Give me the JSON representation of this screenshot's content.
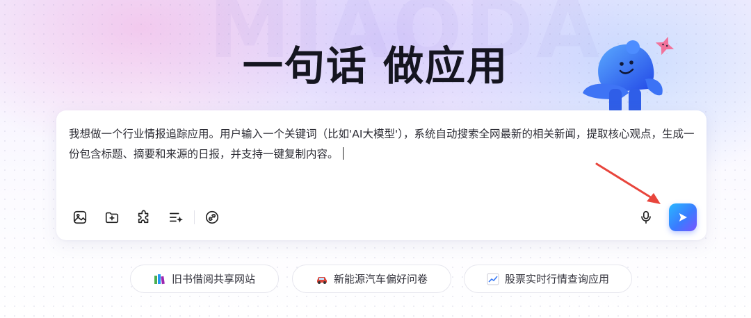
{
  "hero": {
    "watermark": "MIAODA",
    "headline": "一句话 做应用"
  },
  "prompt": {
    "text": "我想做一个行业情报追踪应用。用户输入一个关键词（比如'AI大模型'），系统自动搜索全网最新的相关新闻，提取核心观点，生成一份包含标题、摘要和来源的日报，并支持一键复制内容。"
  },
  "toolbar": {
    "tools": [
      {
        "name": "image-upload-icon"
      },
      {
        "name": "folder-add-icon"
      },
      {
        "name": "plugin-icon"
      },
      {
        "name": "list-sparkle-icon"
      },
      {
        "name": "link-icon"
      }
    ],
    "mic": "microphone-icon",
    "send": "send-icon"
  },
  "suggestions": [
    {
      "icon": "books-emoji",
      "label": "旧书借阅共享网站"
    },
    {
      "icon": "car-emoji",
      "label": "新能源汽车偏好问卷"
    },
    {
      "icon": "chart-emoji",
      "label": "股票实时行情查询应用"
    }
  ],
  "colors": {
    "send_gradient_start": "#29b7ff",
    "send_gradient_end": "#7a55ff",
    "annotation_arrow": "#e8453c",
    "headline": "#151520"
  }
}
